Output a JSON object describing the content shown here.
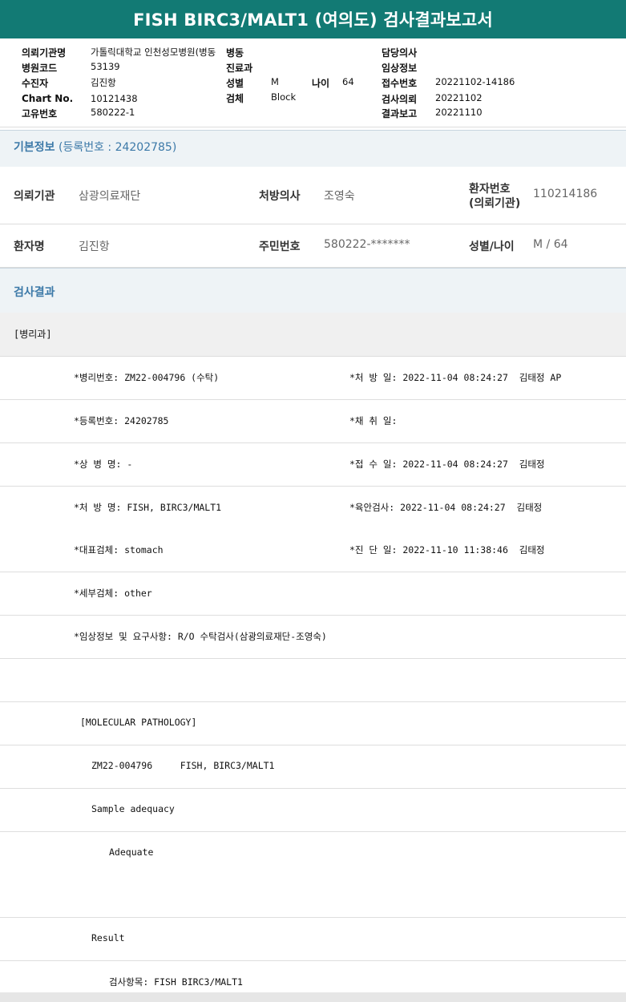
{
  "title": {
    "en": "FISH BIRC3/MALT1 (여의도)",
    "ko": " 검사결과보고서"
  },
  "header": {
    "req_inst_label": "의뢰기관명",
    "req_inst_value": "가톨릭대학교 인천성모병원(병동",
    "hosp_code_label": "병원코드",
    "hosp_code_value": "53139",
    "patient_label": "수진자",
    "patient_value": "김진항",
    "chart_label": "Chart No.",
    "chart_value": "10121438",
    "uid_label": "고유번호",
    "uid_value": "580222-1",
    "ward_label": "병동",
    "dept_label": "진료과",
    "sex_label": "성별",
    "sex_value": "M",
    "age_label": "나이",
    "age_value": "64",
    "specimen_label": "검체",
    "specimen_value": "Block",
    "doctor_label": "담당의사",
    "clinical_label": "임상정보",
    "receipt_label": "접수번호",
    "receipt_value": "20221102-14186",
    "req_date_label": "검사의뢰",
    "req_date_value": "20221102",
    "report_label": "결과보고",
    "report_value": "20221110"
  },
  "basic_info": {
    "title": "기본정보",
    "sub": " (등록번호 : 24202785)"
  },
  "patient_info": {
    "inst_label": "의뢰기관",
    "inst_value": "삼광의료재단",
    "doc_label": "처방의사",
    "doc_value": "조영숙",
    "pno_label_1": "환자번호",
    "pno_label_2": "(의뢰기관)",
    "pno_value": "110214186",
    "name_label": "환자명",
    "name_value": "김진항",
    "ssn_label": "주민번호",
    "ssn_value": "580222-*******",
    "sexage_label": "성별/나이",
    "sexage_value": "M / 64"
  },
  "results_title": "검사결과",
  "dept_tag": "[병리과]",
  "rows": [
    {
      "left": "*병리번호: ZM22-004796 (수탁)",
      "right": "*처 방 일: 2022-11-04 08:24:27  김태정 AP"
    },
    {
      "left": "*등록번호: 24202785",
      "right": "*채 취 일:"
    },
    {
      "left": "*상 병 명: -",
      "right": "*접 수 일: 2022-11-04 08:24:27  김태정"
    },
    {
      "left": "*처 방 명: FISH, BIRC3/MALT1",
      "right": "*육안검사: 2022-11-04 08:24:27  김태정"
    },
    {
      "left": "*대표검체: stomach",
      "right": "*진 단 일: 2022-11-10 11:38:46  김태정"
    },
    {
      "left": "*세부검체: other",
      "right": ""
    },
    {
      "left": "*임상정보 및 요구사항: R/O 수탁검사(삼광의료재단-조영숙)",
      "right": ""
    },
    {
      "left": "",
      "right": ""
    },
    {
      "left": "[MOLECULAR PATHOLOGY]",
      "right": ""
    },
    {
      "left": "ZM22-004796     FISH, BIRC3/MALT1",
      "right": ""
    },
    {
      "left": "Sample adequacy",
      "right": ""
    },
    {
      "left": "Adequate",
      "right": ""
    },
    {
      "left": "",
      "right": ""
    },
    {
      "left": "Result",
      "right": ""
    },
    {
      "left": "검사항목: FISH BIRC3/MALT1",
      "right": ""
    }
  ]
}
